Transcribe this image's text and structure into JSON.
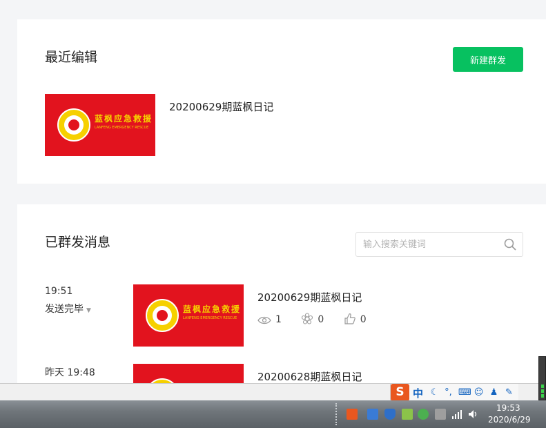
{
  "recent": {
    "title": "最近编辑",
    "new_button": "新建群发",
    "items": [
      {
        "title": "20200629期蓝枫日记"
      }
    ]
  },
  "sent": {
    "title": "已群发消息",
    "search_placeholder": "输入搜索关键词",
    "rows": [
      {
        "time": "19:51",
        "status": "发送完毕",
        "title": "20200629期蓝枫日记",
        "reads": "1",
        "shares": "0",
        "likes": "0"
      },
      {
        "time": "昨天 19:48",
        "title": "20200628期蓝枫日记"
      }
    ]
  },
  "thumbnail": {
    "brand_cn": "蓝枫应急救援",
    "brand_en": "LANFENG EMERGENCY RESCUE"
  },
  "ime": {
    "logo": "S",
    "mode": "中"
  },
  "clock": {
    "time": "19:53",
    "date": "2020/6/29"
  },
  "colors": {
    "primary_green": "#07c160",
    "thumb_red": "#e2131e",
    "thumb_yellow": "#f6d000"
  },
  "icons": {
    "search": "magnifier",
    "reads": "eye",
    "shares": "share-flower",
    "likes": "thumbs-up"
  }
}
